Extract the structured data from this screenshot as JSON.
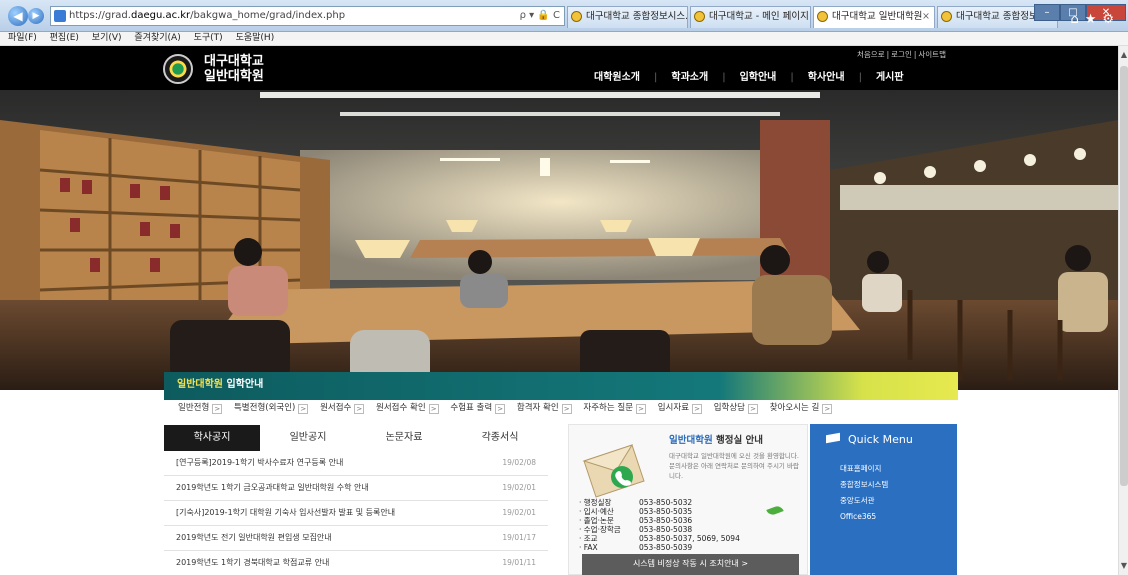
{
  "browser": {
    "url_prefix": "https://grad.",
    "url_domain": "daegu.ac.kr",
    "url_path": "/bakgwa_home/grad/index.php",
    "addr_icons": "ρ ▾ 🔒 C",
    "tabs": [
      {
        "label": "대구대학교 종합정보시스...",
        "active": false
      },
      {
        "label": "대구대학교 - 메인 페이지",
        "active": false
      },
      {
        "label": "대구대학교 일반대학원",
        "active": true
      },
      {
        "label": "대구대학교 종합정보시스...",
        "active": false
      }
    ],
    "menu": [
      "파일(F)",
      "편집(E)",
      "보기(V)",
      "즐겨찾기(A)",
      "도구(T)",
      "도움말(H)"
    ],
    "right_icons": "⌂★⚙"
  },
  "header": {
    "logo_line1": "대구대학교",
    "logo_line2": "일반대학원",
    "util": [
      "처음으로",
      "로그인",
      "사이트맵"
    ],
    "nav": [
      "대학원소개",
      "학과소개",
      "입학안내",
      "학사안내",
      "게시판"
    ]
  },
  "admission": {
    "accent": "일반대학원",
    "title": " 입학안내",
    "links": [
      "일반전형",
      "특별전형(외국인)",
      "원서접수",
      "원서접수 확인",
      "수험표 출력",
      "합격자 확인",
      "자주하는 질문",
      "입시자료",
      "입학상담",
      "찾아오시는 길"
    ]
  },
  "notices": {
    "tabs": [
      "학사공지",
      "일반공지",
      "논문자료",
      "각종서식"
    ],
    "rows": [
      {
        "title": "[연구등록]2019-1학기 박사수료자 연구등록 안내",
        "date": "19/02/08"
      },
      {
        "title": "2019학년도 1학기 금오공과대학교 일반대학원 수학 안내",
        "date": "19/02/01"
      },
      {
        "title": "[기숙사]2019-1학기 대학원 기숙사 입사선발자 발표 및 등록안내",
        "date": "19/02/01"
      },
      {
        "title": "2019학년도 전기 일반대학원 편입생 모집안내",
        "date": "19/01/17"
      },
      {
        "title": "2019학년도 1학기 경북대학교 학점교류 안내",
        "date": "19/01/11"
      }
    ]
  },
  "office": {
    "title_accent": "일반대학원",
    "title_rest": " 행정실 안내",
    "desc": "대구대학교 일반대학원에 오신 것을 환영합니다. 문의사항은 아래 연락처로 문의하여 주시기 바랍니다.",
    "contacts": [
      {
        "label": "· 행정실장",
        "value": "053-850-5032"
      },
      {
        "label": "· 입시·예산",
        "value": "053-850-5035"
      },
      {
        "label": "· 졸업·논문",
        "value": "053-850-5036"
      },
      {
        "label": "· 수업·장학금",
        "value": "053-850-5038"
      },
      {
        "label": "· 조교",
        "value": "053-850-5037, 5069, 5094"
      },
      {
        "label": "· FAX",
        "value": "053-850-5039"
      }
    ],
    "emergency": "시스템 비정상 작동 시 조치안내  >"
  },
  "quick": {
    "title": "Quick Menu",
    "items": [
      "대표홈페이지",
      "종합정보시스템",
      "중앙도서관",
      "Office365"
    ]
  },
  "colors": {
    "brand_blue": "#2b6fc1",
    "teal": "#0d5b5e",
    "accent_yellow": "#f4e04d"
  }
}
